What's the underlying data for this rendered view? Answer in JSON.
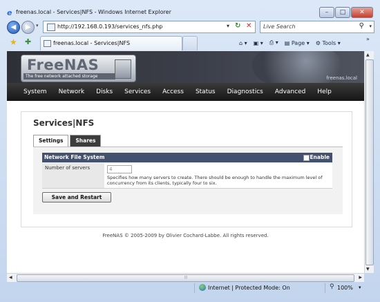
{
  "window": {
    "title": "freenas.local - Services|NFS - Windows Internet Explorer",
    "address": "http://192.168.0.193/services_nfs.php",
    "search_placeholder": "Live Search",
    "tab_label": "freenas.local - Services|NFS",
    "commands": {
      "page": "Page",
      "tools": "Tools"
    },
    "status_zone": "Internet | Protected Mode: On",
    "zoom": "100%"
  },
  "site": {
    "logo": "FreeNAS",
    "tagline": "The free network attached storage",
    "hostname": "freenas.local",
    "menu": [
      "System",
      "Network",
      "Disks",
      "Services",
      "Access",
      "Status",
      "Diagnostics",
      "Advanced",
      "Help"
    ]
  },
  "page": {
    "title": "Services|NFS",
    "tabs": [
      "Settings",
      "Shares"
    ],
    "section_title": "Network File System",
    "enable_label": "Enable",
    "field_label": "Number of servers",
    "field_value": "4",
    "field_help": "Specifies how many servers to create. There should be enough to handle the maximum level of concurrency from its clients, typically four to six.",
    "save_button": "Save and Restart",
    "footer": "FreeNAS © 2005-2009 by Olivier Cochard-Labbe. All rights reserved."
  }
}
